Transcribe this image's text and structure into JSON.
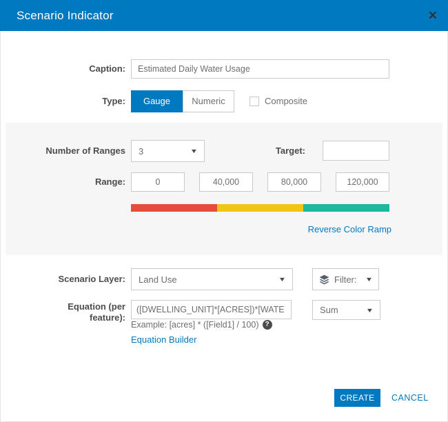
{
  "header": {
    "title": "Scenario Indicator"
  },
  "icons": {
    "caret_down": "▼",
    "close": "✕",
    "help": "?"
  },
  "colors": {
    "accent": "#0079c1",
    "ramp_colors": [
      "#e64c3d",
      "#f0c515",
      "#1eb99d"
    ]
  },
  "caption_row": {
    "label": "Caption:",
    "value": "Estimated Daily Water Usage"
  },
  "type_row": {
    "label": "Type:",
    "gauge": "Gauge",
    "numeric": "Numeric",
    "selected": "Gauge",
    "composite_label": "Composite",
    "composite_checked": false
  },
  "ranges_panel": {
    "number_of_ranges_label": "Number of Ranges",
    "number_of_ranges_value": "3",
    "target_label": "Target:",
    "target_value": "",
    "range_label": "Range:",
    "range_values": [
      "0",
      "40,000",
      "80,000",
      "120,000"
    ],
    "reverse_link": "Reverse Color Ramp"
  },
  "layer_row": {
    "label": "Scenario Layer:",
    "value": "Land Use",
    "filter_label": "Filter:"
  },
  "equation_row": {
    "label_line1": "Equation (per",
    "label_line2": "feature):",
    "value": "([DWELLING_UNIT]*[ACRES])*[WATE",
    "aggregation_value": "Sum",
    "example_text": "Example: [acres] * ([Field1] / 100)",
    "builder_link": "Equation Builder"
  },
  "footer": {
    "create": "CREATE",
    "cancel": "CANCEL"
  }
}
